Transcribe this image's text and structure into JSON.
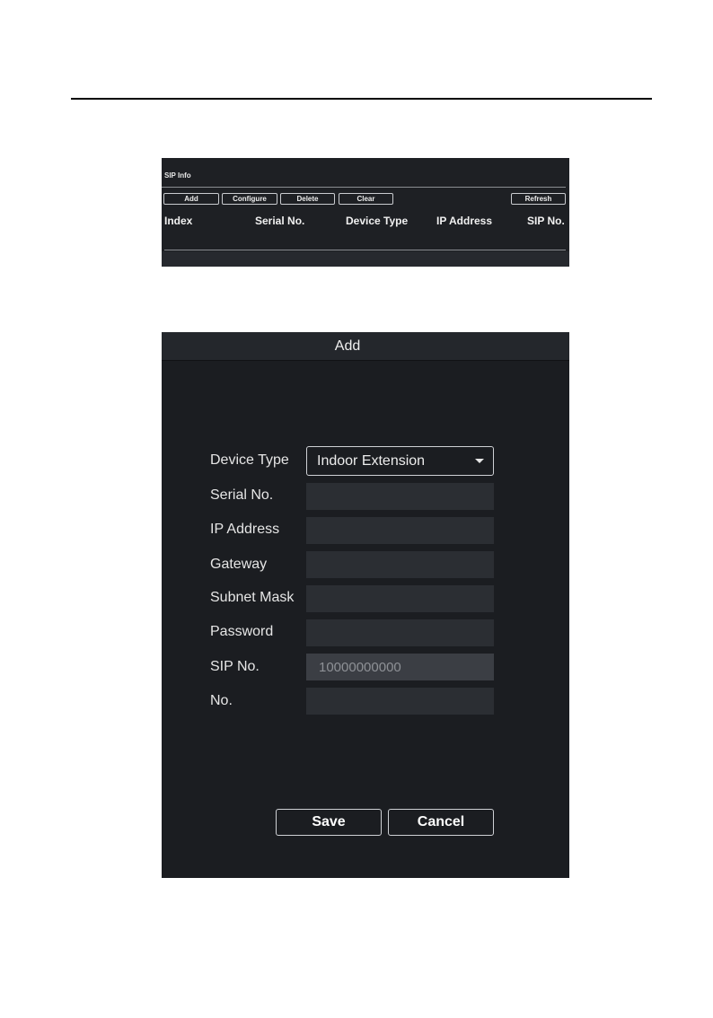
{
  "sip_info": {
    "title": "SIP Info",
    "buttons": {
      "add": "Add",
      "configure": "Configure",
      "delete": "Delete",
      "clear": "Clear",
      "refresh": "Refresh"
    },
    "columns": [
      "Index",
      "Serial No.",
      "Device Type",
      "IP Address",
      "SIP No."
    ]
  },
  "add_dialog": {
    "title": "Add",
    "fields": {
      "device_type": {
        "label": "Device Type",
        "value": "Indoor Extension"
      },
      "serial_no": {
        "label": "Serial No.",
        "value": ""
      },
      "ip_address": {
        "label": "IP Address",
        "value": ""
      },
      "gateway": {
        "label": "Gateway",
        "value": ""
      },
      "subnet_mask": {
        "label": "Subnet Mask",
        "value": ""
      },
      "password": {
        "label": "Password",
        "value": ""
      },
      "sip_no": {
        "label": "SIP No.",
        "value": "10000000000"
      },
      "no": {
        "label": "No.",
        "value": ""
      }
    },
    "save_label": "Save",
    "cancel_label": "Cancel"
  },
  "colors": {
    "panel_bg": "#1e2024",
    "dialog_bg": "#1b1d21",
    "input_bg": "#2b2e33",
    "text": "#f0f0f0"
  }
}
